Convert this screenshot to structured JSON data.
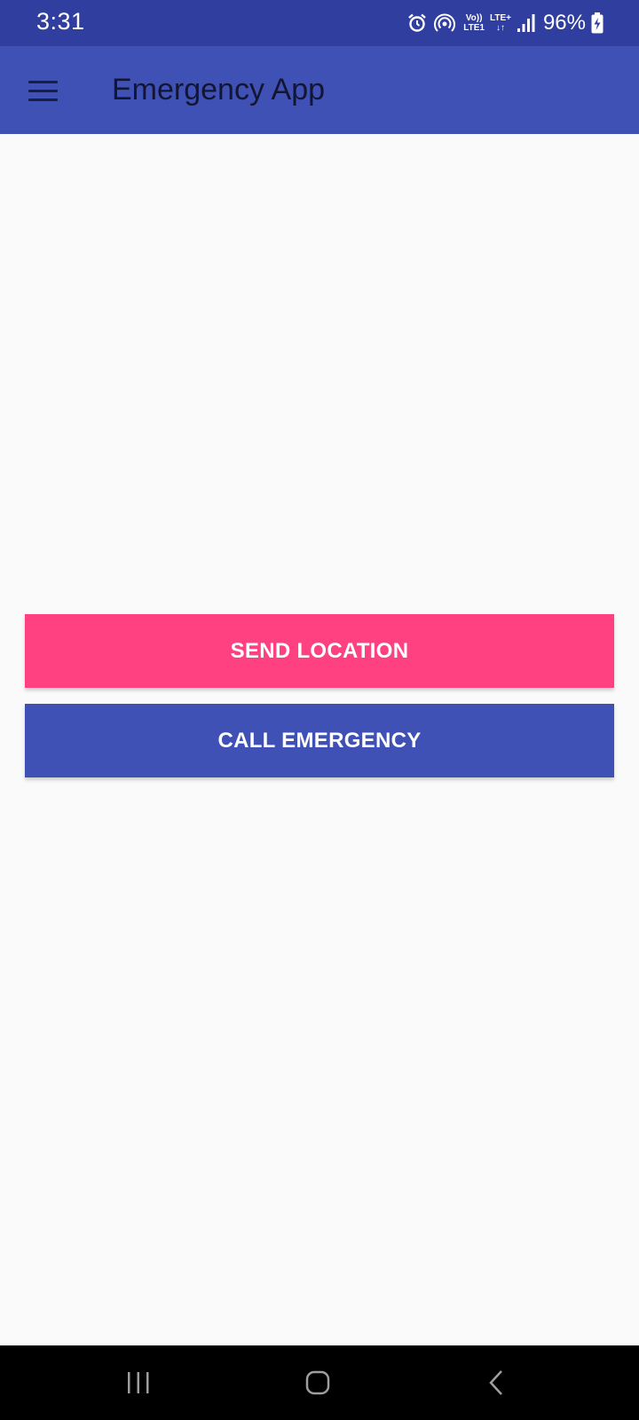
{
  "status_bar": {
    "time": "3:31",
    "volte_top": "Vo))",
    "volte_bottom": "LTE1",
    "lte_top": "LTE+",
    "lte_bottom": "↓↑",
    "battery_percent": "96%",
    "icons": [
      "alarm-icon",
      "hotspot-icon",
      "signal-icon",
      "battery-charging-icon"
    ]
  },
  "app_bar": {
    "menu_icon": "hamburger-menu-icon",
    "title": "Emergency App",
    "background": "#3f51b5"
  },
  "actions": {
    "send_location_label": "SEND LOCATION",
    "send_location_color": "#ff4081",
    "call_emergency_label": "CALL EMERGENCY",
    "call_emergency_color": "#3f51b5"
  },
  "nav_bar": {
    "icons": [
      "recent-apps-icon",
      "home-icon",
      "back-icon"
    ]
  }
}
